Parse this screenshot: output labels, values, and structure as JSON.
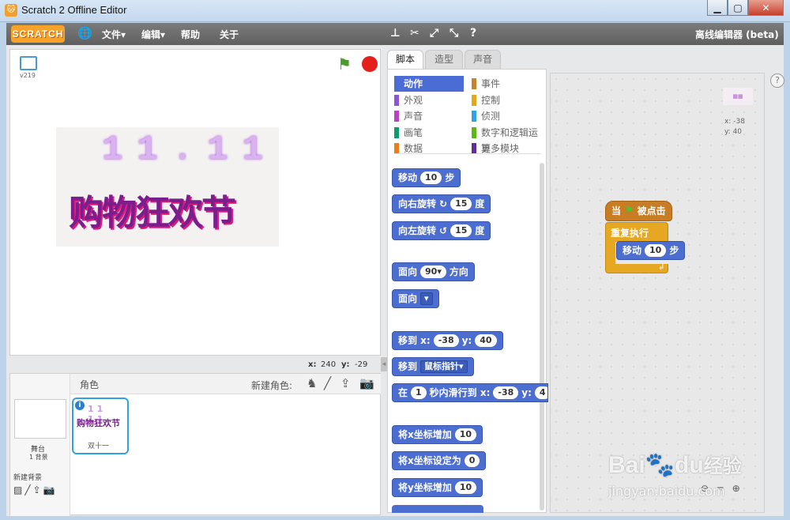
{
  "window": {
    "title": "Scratch 2 Offline Editor",
    "app_icon": "scratch-cat-icon",
    "controls": {
      "minimize": "▁",
      "maximize": "▢",
      "close": "✕"
    }
  },
  "menu": {
    "logo": "SCRATCH",
    "file": "文件▾",
    "edit": "编辑▾",
    "help": "帮助",
    "about": "关于",
    "edition": "离线编辑器 (beta)"
  },
  "stage": {
    "version": "v219",
    "mouse_x_label": "x:",
    "mouse_x": "240",
    "mouse_y_label": "y:",
    "mouse_y": "-29",
    "image_text_top": "11.11",
    "image_text_bottom": "购物狂欢节"
  },
  "sprites": {
    "header": "角色",
    "new_sprite_label": "新建角色:",
    "stage_label": "舞台",
    "stage_backdrops": "1 背景",
    "new_backdrop_label": "新建背景",
    "sprite_name": "双十一",
    "thumb_text": "11 11",
    "thumb_text2": "购物狂欢节",
    "info_icon": "i"
  },
  "tabs": {
    "scripts": "脚本",
    "costumes": "造型",
    "sounds": "声音"
  },
  "categories": [
    {
      "label": "动作",
      "color": "#4a6cd4"
    },
    {
      "label": "外观",
      "color": "#8a55d7"
    },
    {
      "label": "声音",
      "color": "#bb42c3"
    },
    {
      "label": "画笔",
      "color": "#0e9a6c"
    },
    {
      "label": "数据",
      "color": "#ee7d16"
    },
    {
      "label": "事件",
      "color": "#c88330"
    },
    {
      "label": "控制",
      "color": "#e1a91a"
    },
    {
      "label": "侦测",
      "color": "#2ca5e2"
    },
    {
      "label": "数字和逻辑运算",
      "color": "#5cb712"
    },
    {
      "label": "更多模块",
      "color": "#632d99"
    }
  ],
  "palette_blocks": {
    "move": {
      "label": "移动",
      "value": "10",
      "suffix": "步"
    },
    "turn_right": {
      "label": "向右旋转",
      "icon": "↻",
      "value": "15",
      "suffix": "度"
    },
    "turn_left": {
      "label": "向左旋转",
      "icon": "↺",
      "value": "15",
      "suffix": "度"
    },
    "point_dir": {
      "label": "面向",
      "value": "90▾",
      "suffix": "方向"
    },
    "point_towards": {
      "label": "面向",
      "value": "▾"
    },
    "goto_xy": {
      "label": "移到 x:",
      "x": "-38",
      "ylabel": "y:",
      "y": "40"
    },
    "goto": {
      "label": "移到",
      "value": "鼠标指针▾"
    },
    "glide": {
      "label": "在",
      "secs": "1",
      "mid": "秒内滑行到 x:",
      "x": "-38",
      "ylabel": "y:",
      "y": "4"
    },
    "change_x": {
      "label": "将x坐标增加",
      "value": "10"
    },
    "set_x": {
      "label": "将x坐标设定为",
      "value": "0"
    },
    "change_y": {
      "label": "将y坐标增加",
      "value": "10"
    }
  },
  "script": {
    "hat": {
      "pre": "当",
      "post": "被点击"
    },
    "forever": "重复执行",
    "move": {
      "label": "移动",
      "value": "10",
      "suffix": "步"
    },
    "sprite_x": "x: -38",
    "sprite_y": "y: 40",
    "help_icon": "?"
  },
  "watermark": {
    "text1": "Bai",
    "text2": "du",
    "text3": "经验",
    "url": "jingyan.baidu.com"
  }
}
